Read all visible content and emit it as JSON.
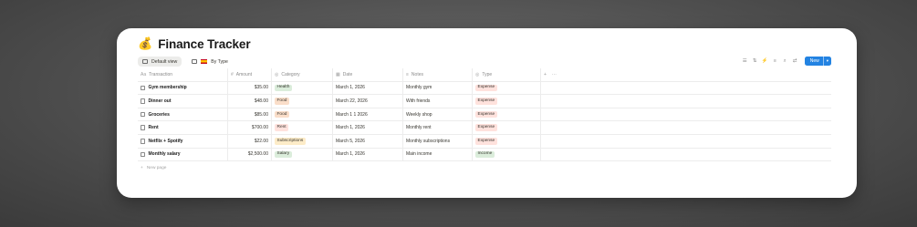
{
  "page": {
    "emoji": "💰",
    "title": "Finance Tracker"
  },
  "views": [
    {
      "label": "Default view",
      "active": true
    },
    {
      "label": "By Type",
      "active": false
    }
  ],
  "toolbar": {
    "icons": [
      "filter-icon",
      "sort-icon",
      "automation-icon",
      "properties-icon",
      "search-icon",
      "settings-icon"
    ],
    "new_label": "New",
    "new_caret": "▾"
  },
  "columns": {
    "transaction": "Transaction",
    "amount": "Amount",
    "category": "Category",
    "date": "Date",
    "notes": "Notes",
    "type": "Type",
    "add": "+",
    "more": "···"
  },
  "rows": [
    {
      "transaction": "Gym membership",
      "amount": "$35.00",
      "category": "Health",
      "category_color": "#dbeddb",
      "date": "March 1, 2026",
      "notes": "Monthly gym",
      "type": "Expense",
      "type_color": "#ffe2dd"
    },
    {
      "transaction": "Dinner out",
      "amount": "$48.00",
      "category": "Food",
      "category_color": "#fadec9",
      "date": "March 22, 2026",
      "notes": "With friends",
      "type": "Expense",
      "type_color": "#ffe2dd"
    },
    {
      "transaction": "Groceries",
      "amount": "$85.00",
      "category": "Food",
      "category_color": "#fadec9",
      "date": "March 1 1 2026",
      "notes": "Weekly shop",
      "type": "Expense",
      "type_color": "#ffe2dd"
    },
    {
      "transaction": "Rent",
      "amount": "$700.00",
      "category": "Rent",
      "category_color": "#ffe2dd",
      "date": "March 1, 2026",
      "notes": "Monthly rent",
      "type": "Expense",
      "type_color": "#ffe2dd"
    },
    {
      "transaction": "Netflix + Spotify",
      "amount": "$22.00",
      "category": "Subscriptions",
      "category_color": "#fdecc8",
      "date": "March 5, 2026",
      "notes": "Monthly subscriptions",
      "type": "Expense",
      "type_color": "#ffe2dd"
    },
    {
      "transaction": "Monthly salary",
      "amount": "$2,500.00",
      "category": "Salary",
      "category_color": "#dbeddb",
      "date": "March 1, 2026",
      "notes": "Main income",
      "type": "Income",
      "type_color": "#dbeddb"
    }
  ],
  "footer": {
    "new_page": "New page"
  },
  "colors": {
    "accent": "#2383e2",
    "tag_text": "#37352f"
  }
}
